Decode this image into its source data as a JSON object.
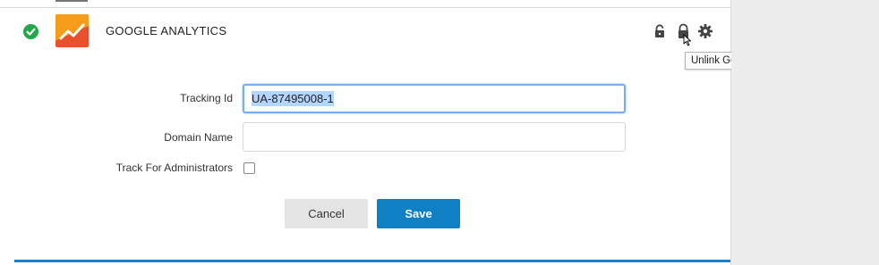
{
  "integration": {
    "title": "GOOGLE ANALYTICS",
    "status_icon": "check-circle-icon",
    "logo_icon": "google-analytics-logo"
  },
  "actions": {
    "lock_icon": "lock-icon",
    "unlink_icon": "unlink-lock-icon",
    "settings_icon": "gear-icon",
    "tooltip": "Unlink Google Analytics Integration"
  },
  "form": {
    "tracking_id": {
      "label": "Tracking Id",
      "value": "UA-87495008-1"
    },
    "domain_name": {
      "label": "Domain Name",
      "value": ""
    },
    "track_admins": {
      "label": "Track For Administrators",
      "checked": false
    }
  },
  "buttons": {
    "cancel": "Cancel",
    "save": "Save"
  },
  "colors": {
    "accent": "#0f80c4",
    "success": "#22a84a",
    "logo_red": "#e8512b",
    "logo_orange": "#f59c1a"
  }
}
